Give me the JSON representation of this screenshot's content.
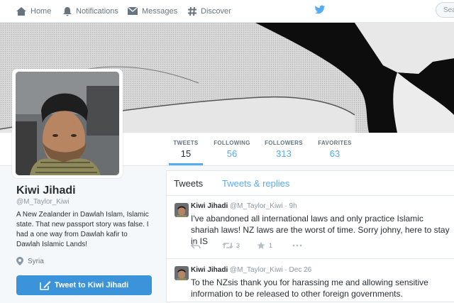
{
  "nav": {
    "home": "Home",
    "notifications": "Notifications",
    "messages": "Messages",
    "discover": "Discover",
    "search_placeholder": "Sea"
  },
  "profile": {
    "name": "Kiwi Jihadi",
    "handle": "@M_Taylor_Kiwi",
    "bio": "A New Zealander in Dawlah Islam, Islamic state. That new passport story was false. I had a one way from Dawlah kafir to Dawlah Islamic Lands!",
    "location": "Syria",
    "tweet_to_label": "Tweet to Kiwi Jihadi"
  },
  "stats": [
    {
      "label": "TWEETS",
      "value": "15"
    },
    {
      "label": "FOLLOWING",
      "value": "56"
    },
    {
      "label": "FOLLOWERS",
      "value": "313"
    },
    {
      "label": "FAVORITES",
      "value": "63"
    }
  ],
  "timeline": {
    "tabs": [
      "Tweets",
      "Tweets & replies"
    ],
    "tweets": [
      {
        "name": "Kiwi Jihadi",
        "handle": "@M_Taylor_Kiwi",
        "time": "9h",
        "text": "I've abandoned all international laws and only practice Islamic shariah laws! NZ laws are the worst of time. Sorry johny, here to stay in IS",
        "retweets": "3",
        "favorites": "1"
      },
      {
        "name": "Kiwi Jihadi",
        "handle": "@M_Taylor_Kiwi",
        "time": "Dec 26",
        "text": "To the NZsis thank you for harassing me and allowing sensitive information to be released to other foreign governments."
      }
    ]
  },
  "colors": {
    "accent": "#55acee",
    "button": "#3b94d9",
    "text": "#292f33",
    "muted": "#8899a6"
  }
}
